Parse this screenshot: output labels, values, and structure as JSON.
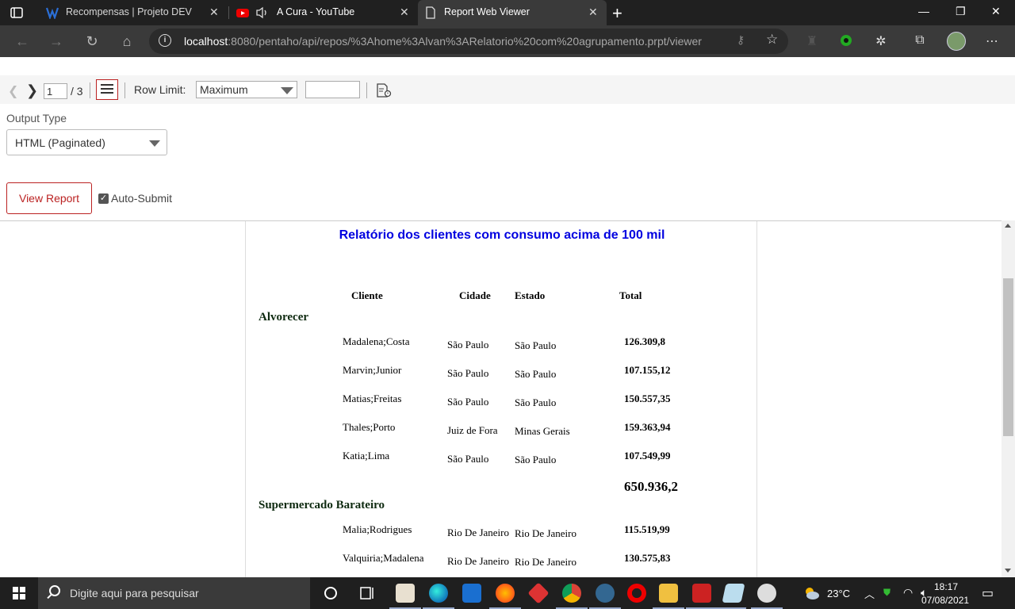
{
  "browser": {
    "tabs": [
      {
        "title": "Recompensas | Projeto DEV",
        "icon": "dev-logo-icon",
        "active": false
      },
      {
        "title": "A Cura - YouTube",
        "icon": "youtube-icon",
        "active": false
      },
      {
        "title": "Report Web Viewer",
        "icon": "page-icon",
        "active": true
      }
    ],
    "url_host": "localhost",
    "url_rest": ":8080/pentaho/api/repos/%3Ahome%3Alvan%3ARelatorio%20com%20agrupamento.prpt/viewer"
  },
  "viewer": {
    "page_current": "1",
    "page_total": "/ 3",
    "row_limit_label": "Row Limit:",
    "row_limit_value": "Maximum",
    "output_type_label": "Output Type",
    "output_type_value": "HTML (Paginated)",
    "view_report_label": "View Report",
    "auto_submit_label": "Auto-Submit",
    "auto_submit_checked": true
  },
  "report": {
    "title": "Relatório dos clientes com consumo acima de 100 mil",
    "columns": [
      "Cliente",
      "Cidade",
      "Estado",
      "Total"
    ],
    "groups": [
      {
        "name": "Alvorecer",
        "rows": [
          [
            "Madalena;Costa",
            "São Paulo",
            "São Paulo",
            "126.309,8"
          ],
          [
            "Marvin;Junior",
            "São Paulo",
            "São Paulo",
            "107.155,12"
          ],
          [
            "Matias;Freitas",
            "São Paulo",
            "São Paulo",
            "150.557,35"
          ],
          [
            "Thales;Porto",
            "Juiz de Fora",
            "Minas Gerais",
            "159.363,94"
          ],
          [
            "Katia;Lima",
            "São Paulo",
            "São Paulo",
            "107.549,99"
          ]
        ],
        "total": "650.936,2"
      },
      {
        "name": "Supermercado Barateiro",
        "rows": [
          [
            "Malia;Rodrigues",
            "Rio De Janeiro",
            "Rio De Janeiro",
            "115.519,99"
          ],
          [
            "Valquiria;Madalena",
            "Rio De Janeiro",
            "Rio De Janeiro",
            "130.575,83"
          ]
        ],
        "total": ""
      }
    ]
  },
  "taskbar": {
    "search_placeholder": "Digite aqui para pesquisar",
    "weather": "23°C",
    "time": "18:17",
    "date": "07/08/2021"
  },
  "colors": {
    "report_title": "#0000e0",
    "accent_red": "#b22222",
    "group_name": "#0e2a10"
  }
}
